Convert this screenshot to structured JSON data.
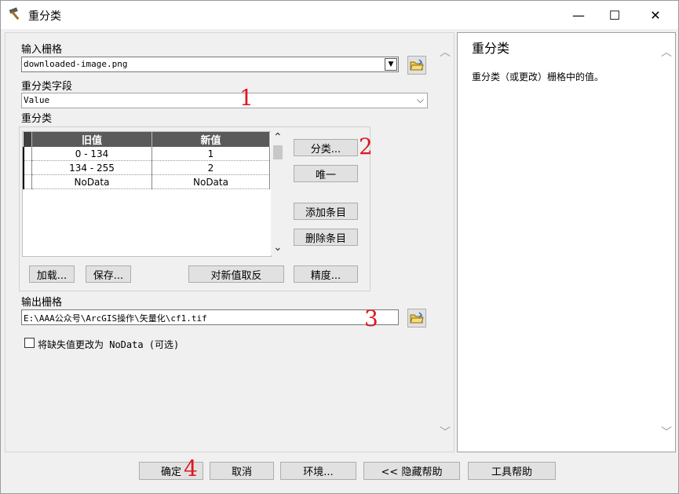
{
  "window": {
    "title": "重分类"
  },
  "controls": {
    "minimize": "—",
    "maximize": "☐",
    "close": "✕"
  },
  "input_raster": {
    "label": "输入栅格",
    "value": "downloaded-image.png"
  },
  "reclass_field": {
    "label": "重分类字段",
    "value": "Value"
  },
  "reclassification": {
    "label": "重分类",
    "headers": [
      "旧值",
      "新值"
    ],
    "rows": [
      {
        "old": "0 - 134",
        "new": "1"
      },
      {
        "old": "134 - 255",
        "new": "2"
      },
      {
        "old": "NoData",
        "new": "NoData"
      }
    ],
    "buttons": {
      "classify": "分类...",
      "unique": "唯一",
      "add_entry": "添加条目",
      "delete_entry": "删除条目",
      "load": "加载...",
      "save": "保存...",
      "reverse": "对新值取反",
      "precision": "精度..."
    }
  },
  "output_raster": {
    "label": "输出栅格",
    "value": "E:\\AAA公众号\\ArcGIS操作\\矢量化\\cf1.tif"
  },
  "nodata_option": {
    "label": "将缺失值更改为 NoData (可选)",
    "checked": false
  },
  "help": {
    "title": "重分类",
    "text": "重分类（或更改）栅格中的值。"
  },
  "footer": {
    "ok": "确定",
    "cancel": "取消",
    "env": "环境...",
    "hide_help": "<< 隐藏帮助",
    "tool_help": "工具帮助"
  },
  "annotations": [
    "1",
    "2",
    "3",
    "4"
  ],
  "icons": {
    "app": "hammer-icon",
    "folder": "open-folder-icon"
  }
}
